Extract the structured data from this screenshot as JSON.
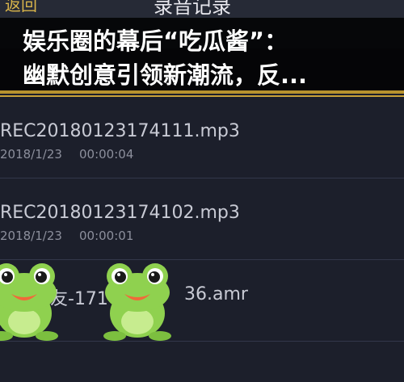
{
  "header": {
    "back_label": "返回",
    "title": "录音记录"
  },
  "recordings": [
    {
      "name": "REC20180123174111.mp3",
      "date": "2018/1/23",
      "duration": "00:00:04"
    },
    {
      "name": "REC20180123174102.mp3",
      "date": "2018/1/23",
      "duration": "00:00:01"
    },
    {
      "name": "蜜友-171",
      "name_tail": "36.amr"
    }
  ],
  "banner": {
    "line1": "娱乐圈的幕后“吃瓜酱”：",
    "line2": "幽默创意引领新潮流，反..."
  },
  "colors": {
    "accent_gold": "#c9a23a",
    "background": "#1c1f2b",
    "frog_green": "#8fd14f"
  },
  "icons": [
    "frog-emoji-icon",
    "frog-emoji-icon"
  ]
}
